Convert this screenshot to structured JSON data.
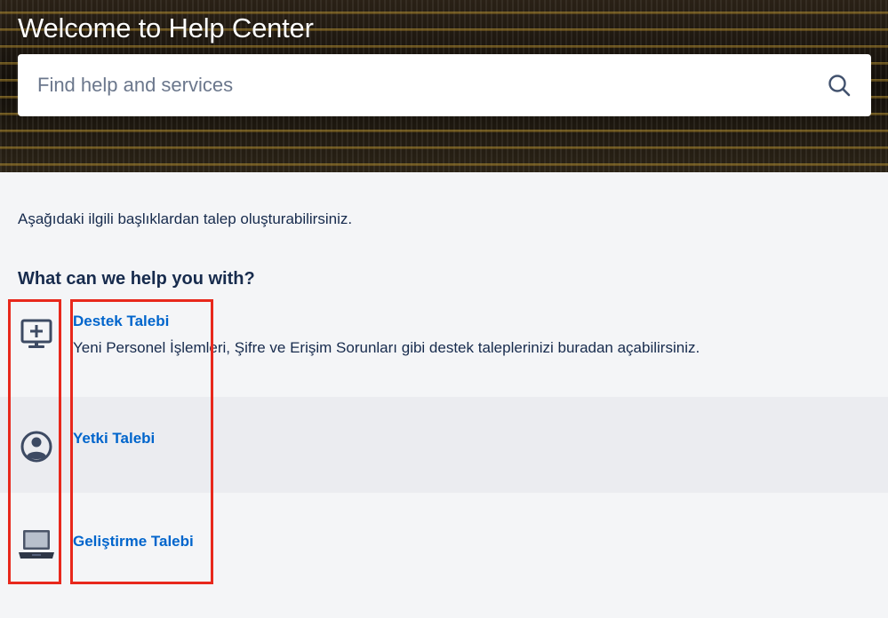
{
  "header": {
    "title": "Welcome to Help Center",
    "search_placeholder": "Find help and services",
    "search_icon": "search-icon"
  },
  "main": {
    "intro_text": "Aşağıdaki ilgili başlıklardan talep oluşturabilirsiniz.",
    "section_title": "What can we help you with?",
    "request_types": [
      {
        "title": "Destek Talebi",
        "description": "Yeni Personel İşlemleri, Şifre ve Erişim Sorunları gibi destek taleplerinizi buradan açabilirsiniz.",
        "icon": "monitor-plus-icon"
      },
      {
        "title": "Yetki Talebi",
        "description": "",
        "icon": "user-circle-icon"
      },
      {
        "title": "Geliştirme Talebi",
        "description": "",
        "icon": "laptop-icon"
      }
    ]
  },
  "colors": {
    "link": "#0065cc",
    "text": "#172b4d",
    "annotation": "#e8281c",
    "row_alt_bg": "#ebecf0"
  }
}
